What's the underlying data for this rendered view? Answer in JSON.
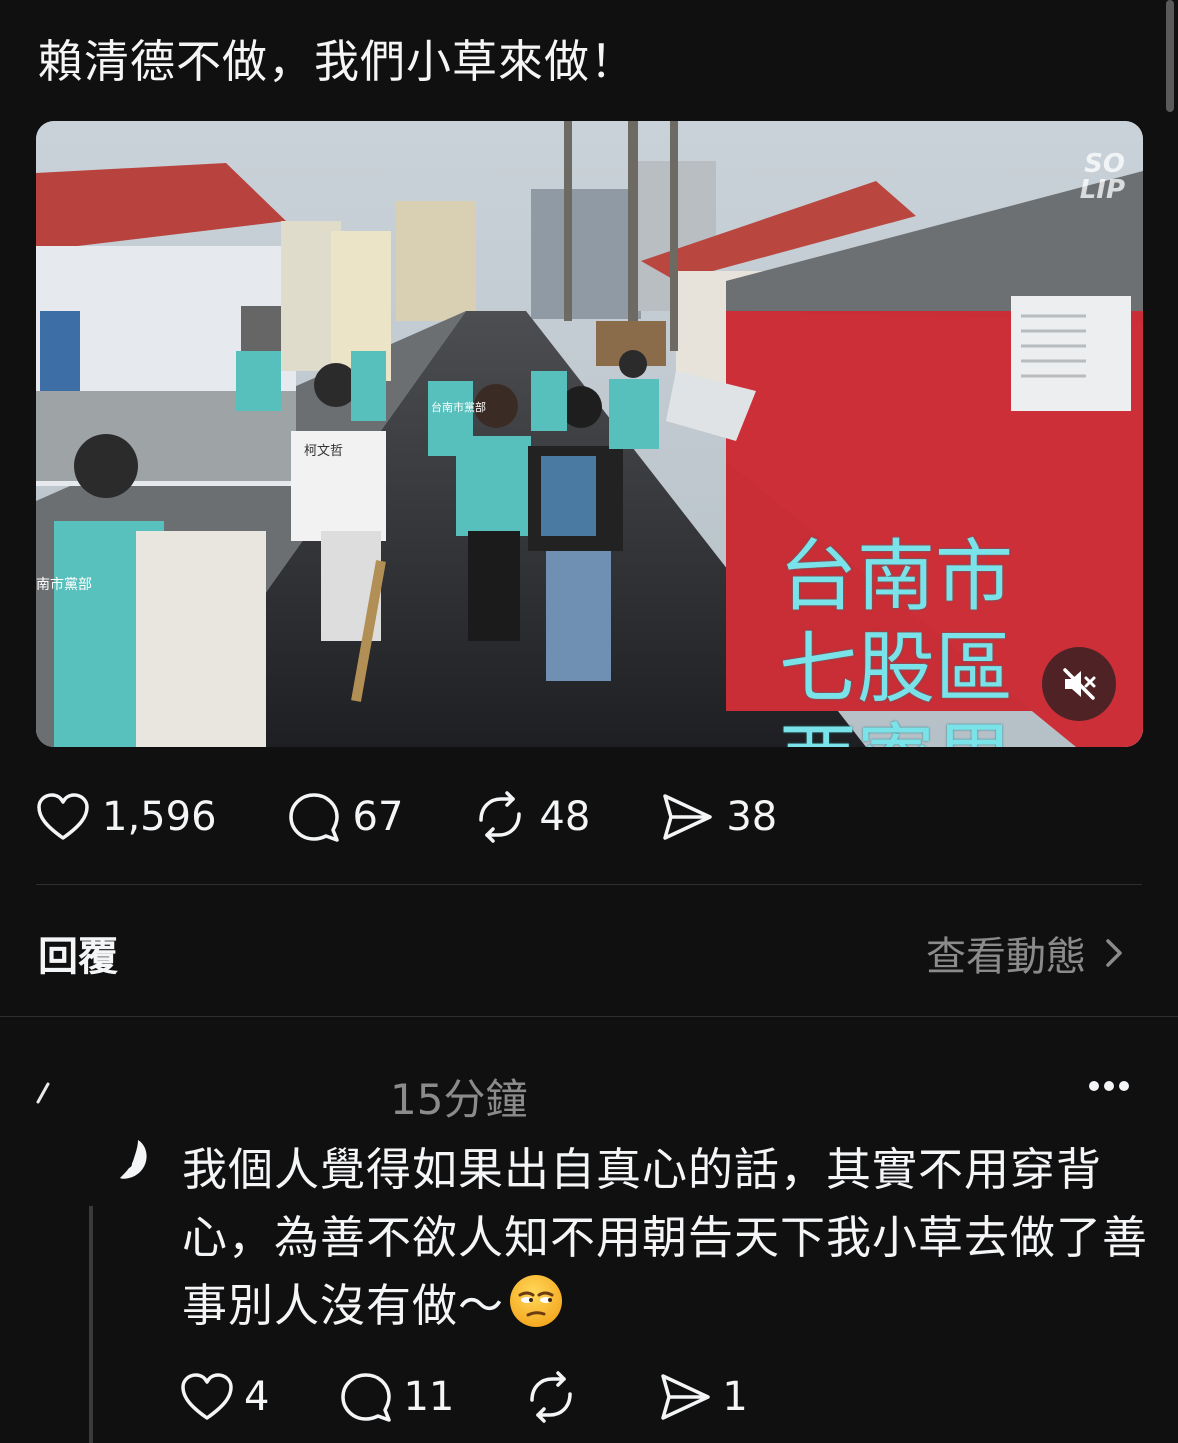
{
  "post": {
    "text": "賴清德不做，我們小草來做！",
    "video": {
      "caption_line1": "台南市",
      "caption_line2": "七股區",
      "caption_line3": "西寮里",
      "watermark_line1": "SO",
      "watermark_line2": "LIP",
      "mute_icon": "speaker-muted-icon",
      "vest_text_1": "柯文哲",
      "vest_text_2": "台南市黨部",
      "vest_text_3": "南市黨部"
    },
    "stats": {
      "likes": "1,596",
      "comments": "67",
      "reposts": "48",
      "shares": "38"
    }
  },
  "replies_header": {
    "label": "回覆",
    "activity_link": "查看動態"
  },
  "reply": {
    "time": "15分鐘",
    "text": "我個人覺得如果出自真心的話，其實不用穿背心，為善不欲人知不用朝告天下我小草去做了善事別人沒有做～",
    "emoji": "unamused-face-emoji",
    "stats": {
      "likes": "4",
      "comments": "11",
      "reposts": "",
      "shares": "1"
    }
  },
  "colors": {
    "background": "#101010",
    "text": "#f3f5f7",
    "muted": "#8b8b8b",
    "caption": "#79e3e9"
  }
}
